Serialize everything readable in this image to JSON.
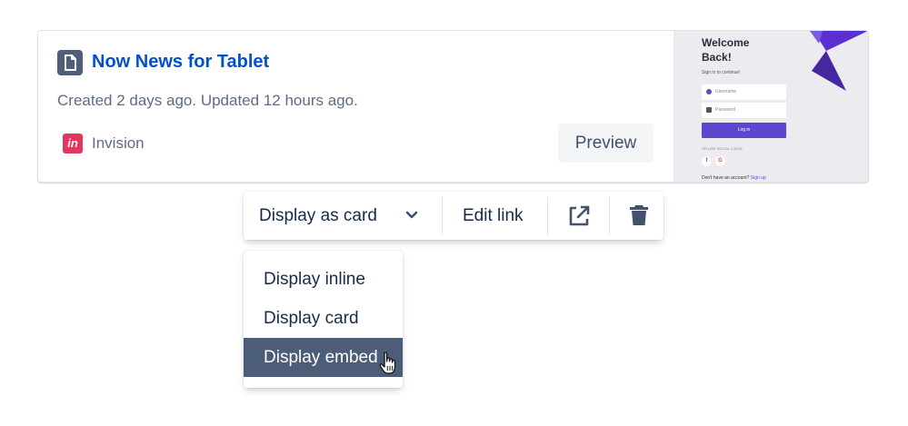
{
  "card": {
    "title": "Now News for Tablet",
    "meta": "Created 2 days ago. Updated 12 hours ago.",
    "provider_name": "Invision",
    "provider_icon_text": "in",
    "preview_label": "Preview",
    "thumbnail": {
      "welcome": "Welcome Back!",
      "subtitle": "Sign in to continue!",
      "username_placeholder": "Username",
      "password_placeholder": "Password",
      "login_label": "Log in",
      "social_label": "OR USE SOCIAL LOGIN",
      "no_account": "Don't have an account?",
      "signup_label": "Sign up",
      "brand_color": "#5b47cf"
    }
  },
  "toolbar": {
    "display_label": "Display as card",
    "edit_label": "Edit link",
    "open_icon": "external-link-icon",
    "delete_icon": "trash-icon"
  },
  "menu": {
    "items": [
      {
        "label": "Display inline",
        "active": false
      },
      {
        "label": "Display card",
        "active": false
      },
      {
        "label": "Display embed",
        "active": true
      }
    ]
  },
  "colors": {
    "link": "#0052cc",
    "active_item": "#4c5d78",
    "provider": "#e0375f"
  }
}
